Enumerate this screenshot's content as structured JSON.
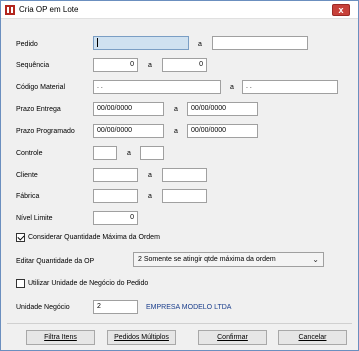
{
  "window": {
    "title": "Cria OP em Lote",
    "close_label": "x"
  },
  "form": {
    "pedido": {
      "label": "Pedido",
      "from": "",
      "to": ""
    },
    "sequencia": {
      "label": "Sequência",
      "from": "0",
      "to": "0"
    },
    "codigo_material": {
      "label": "Código Material",
      "from": "  .  .",
      "to": "  .  ."
    },
    "prazo_entrega": {
      "label": "Prazo Entrega",
      "from": "00/00/0000",
      "to": "00/00/0000"
    },
    "prazo_programado": {
      "label": "Prazo Programado",
      "from": "00/00/0000",
      "to": "00/00/0000"
    },
    "controle": {
      "label": "Controle",
      "from": "",
      "to": ""
    },
    "cliente": {
      "label": "Cliente",
      "from": "",
      "to": ""
    },
    "fabrica": {
      "label": "Fábrica",
      "from": "",
      "to": ""
    },
    "nivel_limite": {
      "label": "Nível Limite",
      "value": "0"
    },
    "range_separator": "a"
  },
  "options": {
    "considerar_qtd_max": {
      "label": "Considerar Quantidade Máxima da Ordem",
      "checked": true
    },
    "editar_qtd_op": {
      "label": "Editar Quantidade da OP",
      "selected": "2 Somente se atingir qtde máxima da ordem"
    },
    "utilizar_unidade": {
      "label": "Utilizar Unidade de Negócio do Pedido",
      "checked": false
    },
    "unidade_negocio": {
      "label": "Unidade Negócio",
      "value": "2",
      "company": "EMPRESA MODELO LTDA"
    }
  },
  "buttons": {
    "filtra_itens": "Filtra Itens",
    "pedidos_multiplos": "Pedidos Múltiplos",
    "confirmar": "Confirmar",
    "cancelar": "Cancelar"
  },
  "colors": {
    "focused_field": "#cfe1f0",
    "company_text": "#1a3e8c",
    "close_button": "#c7413a",
    "icon": "#b3261e"
  }
}
